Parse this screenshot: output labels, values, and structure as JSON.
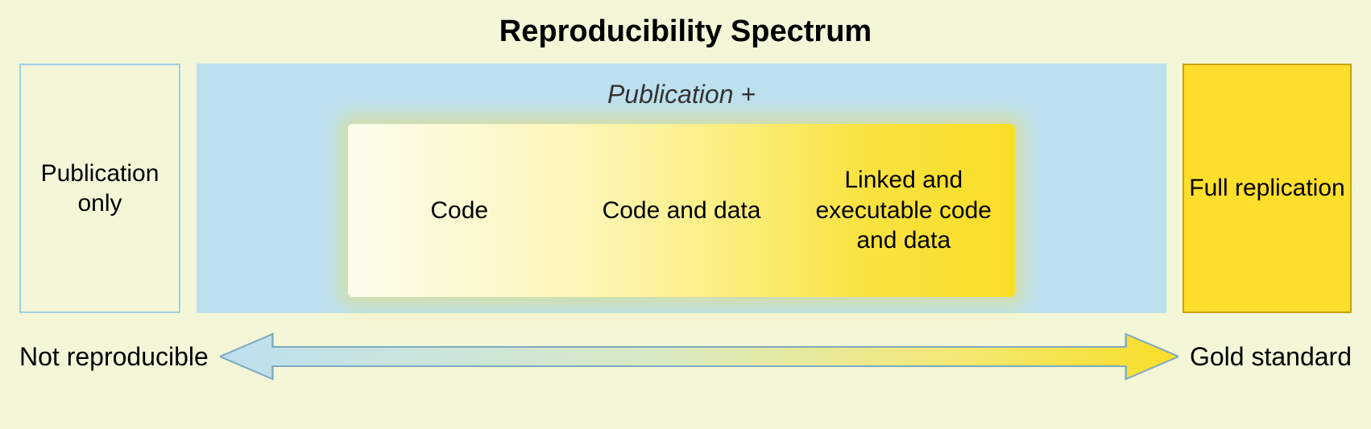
{
  "title": "Reproducibility Spectrum",
  "left_panel": "Publication only",
  "mid_header": "Publication +",
  "spectrum": {
    "s1": "Code",
    "s2": "Code and data",
    "s3": "Linked and executable code and data"
  },
  "right_panel": "Full replication",
  "bottom_left": "Not reproducible",
  "bottom_right": "Gold standard"
}
